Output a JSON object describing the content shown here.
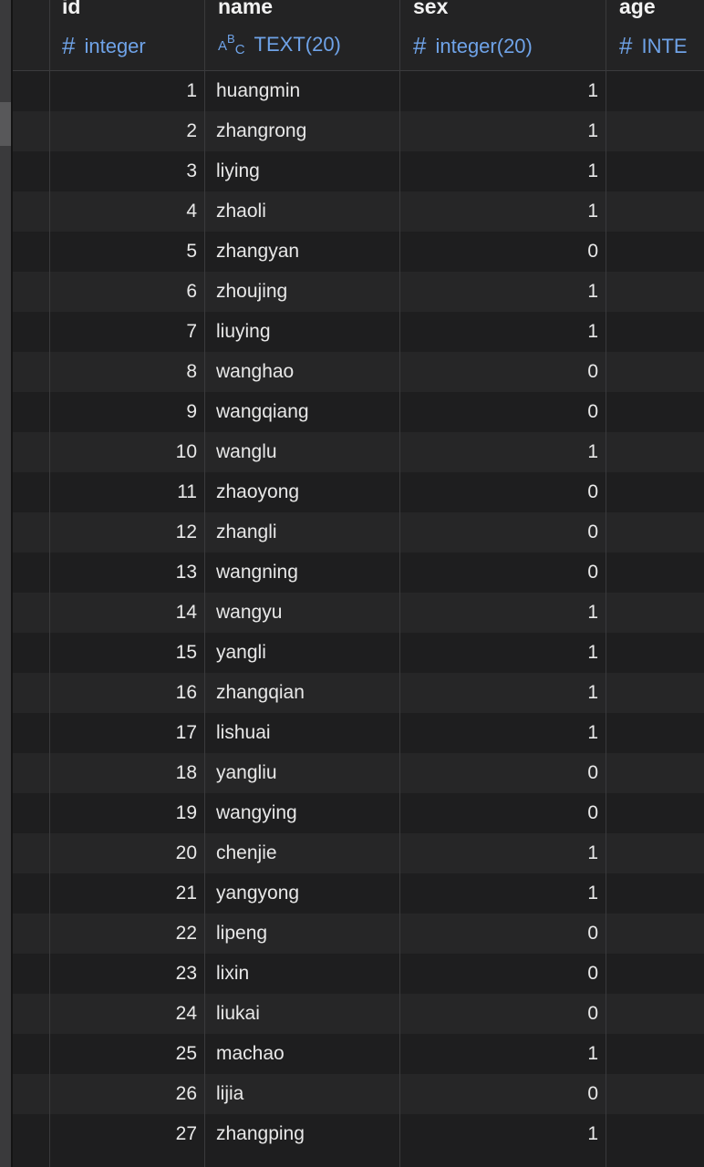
{
  "columns": [
    {
      "name": "id",
      "type": "integer",
      "icon": "hash-icon"
    },
    {
      "name": "name",
      "type": "TEXT(20)",
      "icon": "text-type-icon"
    },
    {
      "name": "sex",
      "type": "integer(20)",
      "icon": "hash-icon"
    },
    {
      "name": "age",
      "type": "INTE",
      "icon": "hash-icon"
    }
  ],
  "rows": [
    {
      "id": "1",
      "name": "huangmin",
      "sex": "1"
    },
    {
      "id": "2",
      "name": "zhangrong",
      "sex": "1"
    },
    {
      "id": "3",
      "name": "liying",
      "sex": "1"
    },
    {
      "id": "4",
      "name": "zhaoli",
      "sex": "1"
    },
    {
      "id": "5",
      "name": "zhangyan",
      "sex": "0"
    },
    {
      "id": "6",
      "name": "zhoujing",
      "sex": "1"
    },
    {
      "id": "7",
      "name": "liuying",
      "sex": "1"
    },
    {
      "id": "8",
      "name": "wanghao",
      "sex": "0"
    },
    {
      "id": "9",
      "name": "wangqiang",
      "sex": "0"
    },
    {
      "id": "10",
      "name": "wanglu",
      "sex": "1"
    },
    {
      "id": "11",
      "name": "zhaoyong",
      "sex": "0"
    },
    {
      "id": "12",
      "name": "zhangli",
      "sex": "0"
    },
    {
      "id": "13",
      "name": "wangning",
      "sex": "0"
    },
    {
      "id": "14",
      "name": "wangyu",
      "sex": "1"
    },
    {
      "id": "15",
      "name": "yangli",
      "sex": "1"
    },
    {
      "id": "16",
      "name": "zhangqian",
      "sex": "1"
    },
    {
      "id": "17",
      "name": "lishuai",
      "sex": "1"
    },
    {
      "id": "18",
      "name": "yangliu",
      "sex": "0"
    },
    {
      "id": "19",
      "name": "wangying",
      "sex": "0"
    },
    {
      "id": "20",
      "name": "chenjie",
      "sex": "1"
    },
    {
      "id": "21",
      "name": "yangyong",
      "sex": "1"
    },
    {
      "id": "22",
      "name": "lipeng",
      "sex": "0"
    },
    {
      "id": "23",
      "name": "lixin",
      "sex": "0"
    },
    {
      "id": "24",
      "name": "liukai",
      "sex": "0"
    },
    {
      "id": "25",
      "name": "machao",
      "sex": "1"
    },
    {
      "id": "26",
      "name": "lijia",
      "sex": "0"
    },
    {
      "id": "27",
      "name": "zhangping",
      "sex": "1"
    }
  ],
  "colors": {
    "background": "#1e1e1f",
    "row_alt": "#262627",
    "type_text": "#6fa3e8",
    "grid_line": "#3a3a3c"
  }
}
